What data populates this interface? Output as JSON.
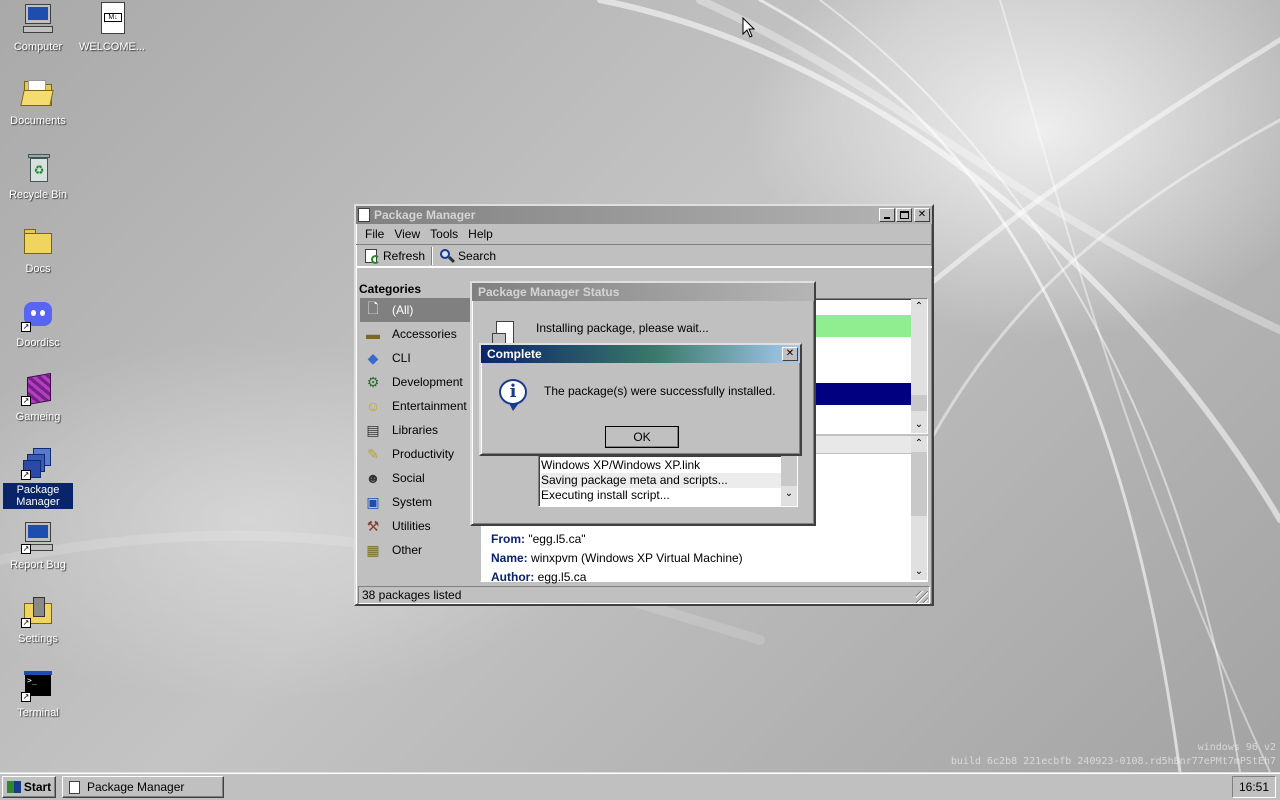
{
  "desktop": {
    "icons": [
      {
        "label": "Computer"
      },
      {
        "label": "WELCOME..."
      },
      {
        "label": "Documents"
      },
      {
        "label": "Recycle Bin"
      },
      {
        "label": "Docs"
      },
      {
        "label": "Doordisc"
      },
      {
        "label": "Gameing"
      },
      {
        "label": "Package Manager"
      },
      {
        "label": "Report Bug"
      },
      {
        "label": "Settings"
      },
      {
        "label": "Terminal"
      }
    ],
    "watermark_line1": "windows 96 v2",
    "watermark_line2": "build 6c2b8 221ecbfb 240923-0108.rd5hBnr77ePMt7mPStEh7"
  },
  "package_manager": {
    "title": "Package Manager",
    "menu": [
      "File",
      "View",
      "Tools",
      "Help"
    ],
    "toolbar": {
      "refresh": "Refresh",
      "search": "Search"
    },
    "categories_header": "Categories",
    "categories": [
      {
        "label": "(All)",
        "icon": "document-icon"
      },
      {
        "label": "Accessories",
        "icon": "toolbox-icon"
      },
      {
        "label": "CLI",
        "icon": "diamond-icon"
      },
      {
        "label": "Development",
        "icon": "gears-icon"
      },
      {
        "label": "Entertainment",
        "icon": "smiley-icon"
      },
      {
        "label": "Libraries",
        "icon": "book-icon"
      },
      {
        "label": "Productivity",
        "icon": "notepad-icon"
      },
      {
        "label": "Social",
        "icon": "people-icon"
      },
      {
        "label": "System",
        "icon": "monitor-icon"
      },
      {
        "label": "Utilities",
        "icon": "tools-icon"
      },
      {
        "label": "Other",
        "icon": "package-icon"
      }
    ],
    "details": {
      "from_label": "From:",
      "from_value": "\"egg.l5.ca\"",
      "name_label": "Name:",
      "name_value": "winxpvm (Windows XP Virtual Machine)",
      "author_label": "Author:",
      "author_value": "egg.l5.ca"
    },
    "status_bar": "38 packages listed",
    "colors": {
      "installed_row": "#90ee90",
      "selected_row": "#000080"
    }
  },
  "status_dialog": {
    "title": "Package Manager Status",
    "message": "Installing package, please wait...",
    "log": [
      "Windows XP/Windows XP.link",
      "Saving package meta and scripts...",
      "Executing install script..."
    ]
  },
  "complete_dialog": {
    "title": "Complete",
    "message": "The package(s) were successfully installed.",
    "ok": "OK"
  },
  "taskbar": {
    "start": "Start",
    "task": "Package Manager",
    "clock": "16:51"
  }
}
